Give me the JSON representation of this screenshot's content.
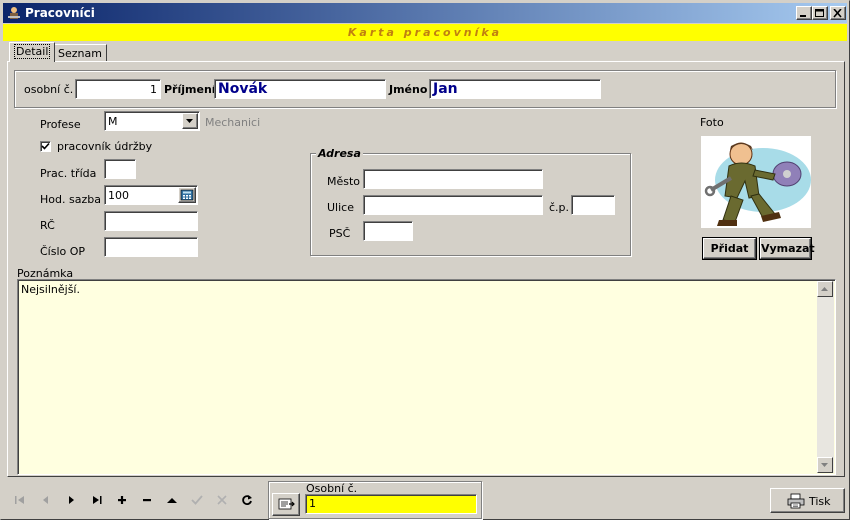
{
  "window": {
    "title": "Pracovníci",
    "banner": "Karta pracovníka"
  },
  "tabs": [
    {
      "label": "Detail"
    },
    {
      "label": "Seznam"
    }
  ],
  "header": {
    "osobni_label": "osobní č.",
    "osobni_value": "1",
    "prijmeni_label": "Příjmení",
    "prijmeni_value": "Novák",
    "jmeno_label": "Jméno",
    "jmeno_value": "Jan"
  },
  "left": {
    "profese_label": "Profese",
    "profese_value": "M",
    "profese_desc": "Mechanici",
    "udrzba_label": "pracovník údržby",
    "udrzba_checked": true,
    "trida_label": "Prac. třída",
    "trida_value": "",
    "sazba_label": "Hod. sazba",
    "sazba_value": "100",
    "rc_label": "RČ",
    "rc_value": "",
    "op_label": "Číslo OP",
    "op_value": ""
  },
  "adresa": {
    "legend": "Adresa",
    "mesto_label": "Město",
    "mesto_value": "",
    "ulice_label": "Ulice",
    "ulice_value": "",
    "cp_label": "č.p.",
    "cp_value": "",
    "psc_label": "PSČ",
    "psc_value": ""
  },
  "foto": {
    "label": "Foto",
    "add_label": "Přidat",
    "delete_label": "Vymazat"
  },
  "poznamka": {
    "label": "Poznámka",
    "value": "Nejsilnější."
  },
  "footer": {
    "osobni_label": "Osobní č.",
    "osobni_value": "1",
    "print_label": "Tisk"
  },
  "colors": {
    "banner_bg": "#ffff00",
    "banner_text": "#c08010",
    "memo_bg": "#ffffe0",
    "name_text": "#00008b"
  }
}
